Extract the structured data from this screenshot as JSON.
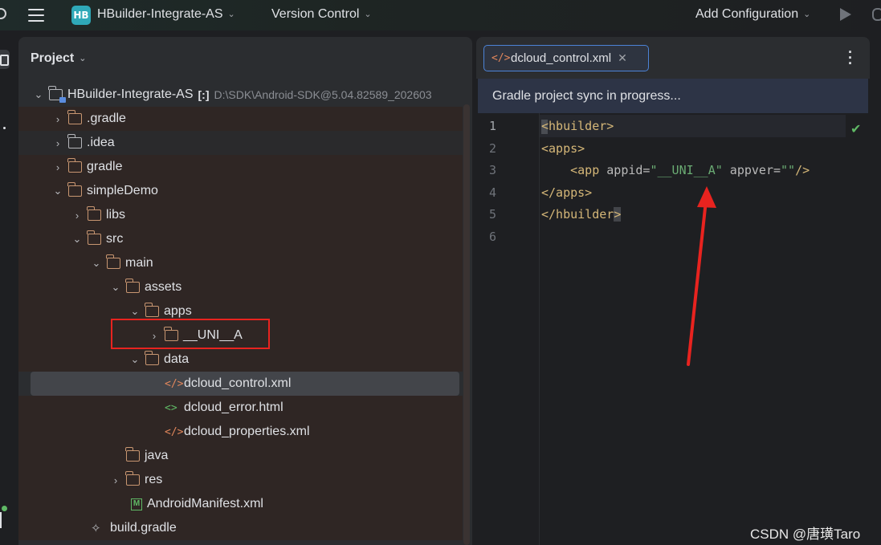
{
  "topbar": {
    "project_logo": "HB",
    "project_name": "HBuilder-Integrate-AS",
    "version_control": "Version Control",
    "add_configuration": "Add Configuration"
  },
  "project_panel": {
    "title": "Project",
    "tree": [
      {
        "label": "HBuilder-Integrate-AS",
        "vcs": "[:]",
        "path": "D:\\SDK\\Android-SDK@5.04.82589_202603",
        "type": "project",
        "level": 0,
        "expanded": true
      },
      {
        "label": ".gradle",
        "type": "folder",
        "level": 1,
        "expanded": false
      },
      {
        "label": ".idea",
        "type": "folder-grey",
        "level": 1,
        "expanded": false
      },
      {
        "label": "gradle",
        "type": "folder",
        "level": 1,
        "expanded": false
      },
      {
        "label": "simpleDemo",
        "type": "folder",
        "level": 1,
        "expanded": true
      },
      {
        "label": "libs",
        "type": "folder",
        "level": 2,
        "expanded": false
      },
      {
        "label": "src",
        "type": "folder",
        "level": 2,
        "expanded": true
      },
      {
        "label": "main",
        "type": "folder",
        "level": 3,
        "expanded": true
      },
      {
        "label": "assets",
        "type": "folder",
        "level": 4,
        "expanded": true
      },
      {
        "label": "apps",
        "type": "folder",
        "level": 5,
        "expanded": true
      },
      {
        "label": "__UNI__A",
        "type": "folder",
        "level": 6,
        "expanded": false
      },
      {
        "label": "data",
        "type": "folder",
        "level": 5,
        "expanded": true
      },
      {
        "label": "dcloud_control.xml",
        "type": "xml",
        "level": 6,
        "selected": true
      },
      {
        "label": "dcloud_error.html",
        "type": "html",
        "level": 6
      },
      {
        "label": "dcloud_properties.xml",
        "type": "xml",
        "level": 6
      },
      {
        "label": "java",
        "type": "folder",
        "level": 4
      },
      {
        "label": "res",
        "type": "folder",
        "level": 4,
        "expanded": false
      },
      {
        "label": "AndroidManifest.xml",
        "type": "manifest",
        "level": 4
      },
      {
        "label": "build.gradle",
        "type": "gradle",
        "level": 2
      }
    ]
  },
  "editor": {
    "tab_label": "dcloud_control.xml",
    "banner": "Gradle project sync in progress...",
    "line_numbers": [
      "1",
      "2",
      "3",
      "4",
      "5",
      "6"
    ],
    "code": {
      "l1_tag": "hbuilder",
      "l2_tag": "<apps>",
      "l3_indent": "    ",
      "l3_open": "<app ",
      "l3_attr1": "appid=",
      "l3_val1": "\"__UNI__A\"",
      "l3_attr2": " appver=",
      "l3_val2": "\"\"",
      "l3_close": "/>",
      "l4_tag": "</apps>",
      "l5_tag": "</hbuilder",
      "l5_end": ">"
    }
  },
  "watermark": "CSDN @唐璜Taro",
  "colors": {
    "annotation_red": "#e8231f",
    "accent_blue": "#4c83d6",
    "xml_tag": "#d5b778",
    "xml_string": "#6aab73",
    "folder": "#c89671"
  }
}
